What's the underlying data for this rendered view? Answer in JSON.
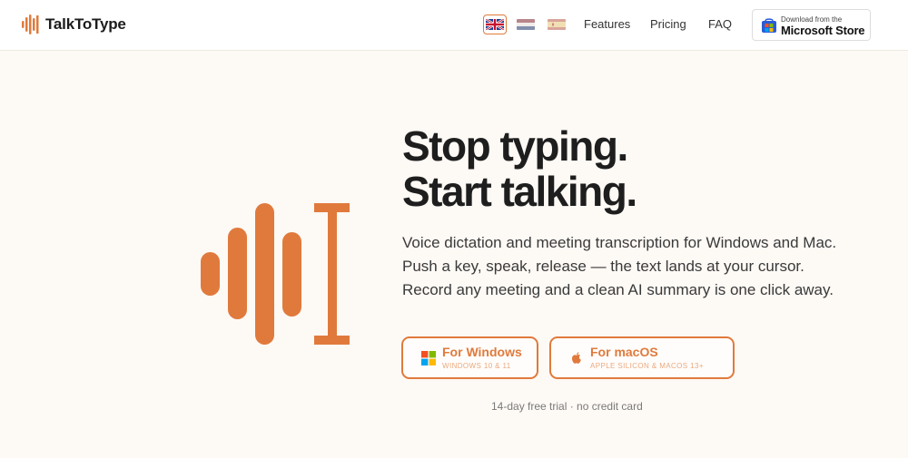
{
  "brand": {
    "name": "TalkToType",
    "accent": "#e07a3c"
  },
  "languages": [
    {
      "code": "en",
      "icon": "uk-flag-icon",
      "active": true
    },
    {
      "code": "nl",
      "icon": "netherlands-flag-icon",
      "active": false
    },
    {
      "code": "es",
      "icon": "spain-flag-icon",
      "active": false
    }
  ],
  "nav": {
    "features": "Features",
    "pricing": "Pricing",
    "faq": "FAQ"
  },
  "store_badge": {
    "small": "Download from the",
    "big": "Microsoft Store",
    "icon": "microsoft-store-icon"
  },
  "hero": {
    "headline_line1": "Stop typing.",
    "headline_line2": "Start talking.",
    "description_line1": "Voice dictation and meeting transcription for Windows and Mac.",
    "description_line2": "Push a key, speak, release — the text lands at your cursor.",
    "description_line3": "Record any meeting and a clean AI summary is one click away.",
    "graphic_icon": "soundwave-cursor-icon"
  },
  "buttons": {
    "windows": {
      "title": "For Windows",
      "subtitle": "WINDOWS 10 & 11",
      "icon": "windows-logo-icon"
    },
    "mac": {
      "title": "For macOS",
      "subtitle": "APPLE SILICON & MACOS 13+",
      "icon": "apple-logo-icon"
    }
  },
  "trial_note": "14-day free trial · no credit card"
}
